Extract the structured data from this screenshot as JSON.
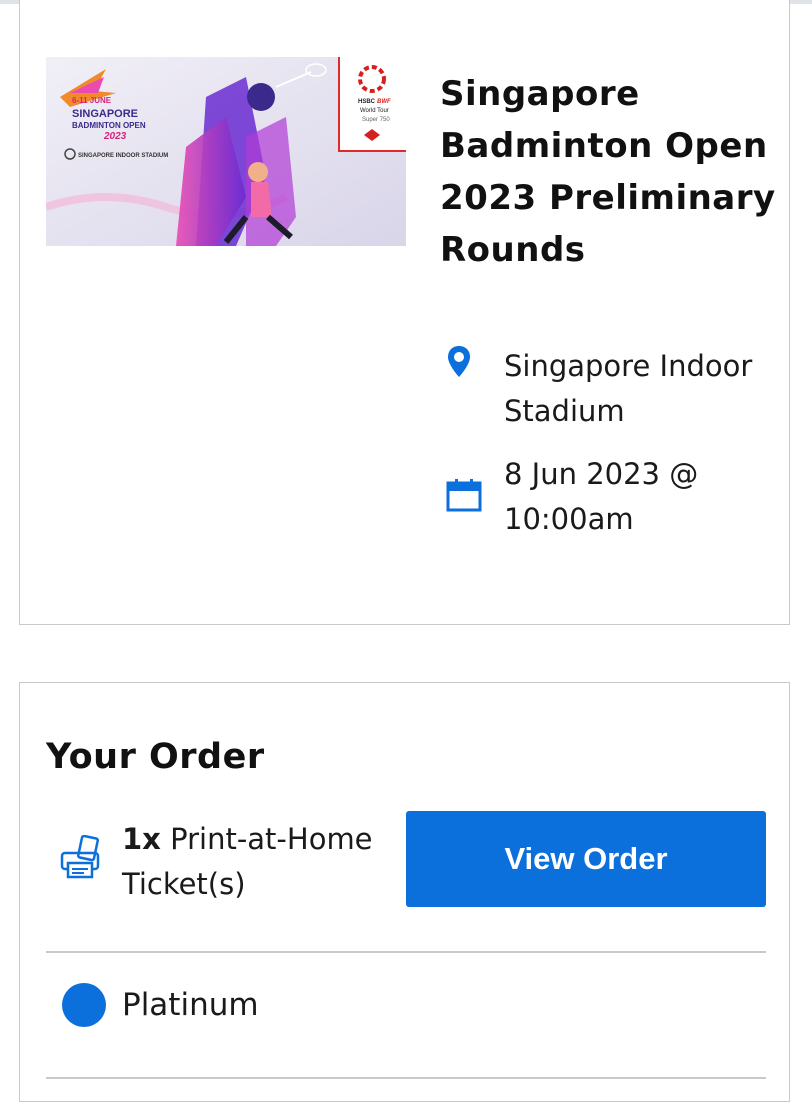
{
  "event": {
    "banner": {
      "dates": "6-11 JUNE",
      "name_line1": "SINGAPORE",
      "name_line2": "BADMINTON OPEN",
      "year": "2023",
      "venue_logo_text": "SINGAPORE INDOOR STADIUM",
      "sponsor_line1": "HSBC",
      "sponsor_line2": "BWF",
      "sponsor_line3": "World Tour",
      "sponsor_line4": "Super 750"
    },
    "title": "Singapore Badminton Open 2023 Preliminary Rounds",
    "venue": "Singapore Indoor Stadium",
    "datetime": "8 Jun 2023 @ 10:00am",
    "icons": {
      "venue": "map-pin-icon",
      "date": "calendar-icon"
    },
    "accent_color": "#0b6fdc"
  },
  "order": {
    "heading": "Your Order",
    "quantity": "1x",
    "ticket_type": "Print-at-Home Ticket(s)",
    "button_label": "View Order",
    "tier": "Platinum",
    "tier_color": "#0b6fdc",
    "icons": {
      "ticket": "printer-icon"
    }
  }
}
